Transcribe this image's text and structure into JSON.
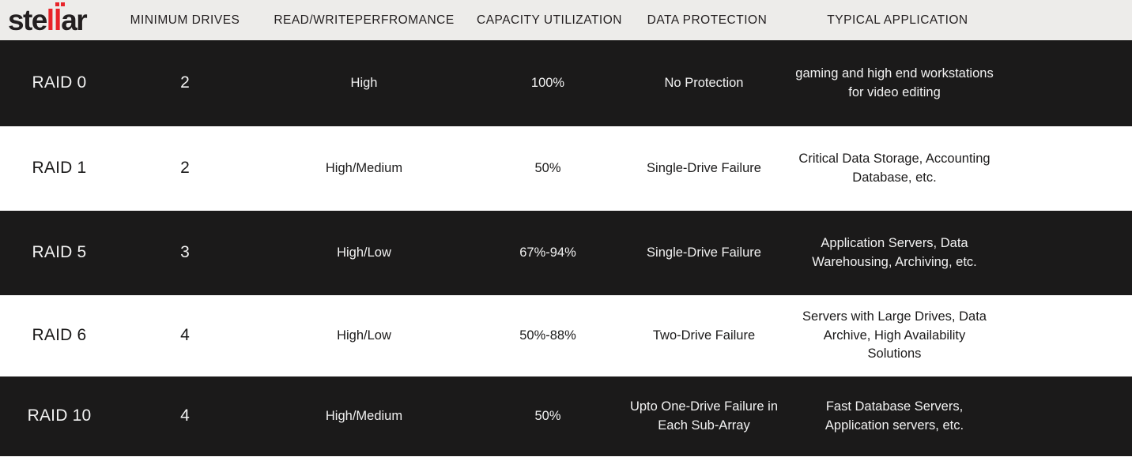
{
  "brand": {
    "name": "stellar",
    "name_part1": "ste",
    "name_part2": "ll",
    "name_part3": "ar",
    "accent_color": "#e8242a",
    "text_color": "#231f20"
  },
  "theme": {
    "header_bg": "#edecea",
    "dark_row_bg": "#1b1a1a",
    "light_row_bg": "#ffffff",
    "dark_row_text": "#f2f2f2",
    "light_row_text": "#1b1a1a"
  },
  "table": {
    "columns": [
      "",
      "MINIMUM DRIVES",
      "READ/WRITEPERFROMANCE",
      "CAPACITY UTILIZATION",
      "DATA PROTECTION",
      "TYPICAL APPLICATION"
    ],
    "rows": [
      {
        "level": "RAID 0",
        "minimum_drives": "2",
        "read_write_performance": "High",
        "capacity_utilization": "100%",
        "data_protection": "No Protection",
        "typical_application": "gaming and high end workstations for video editing",
        "style": "dark"
      },
      {
        "level": "RAID 1",
        "minimum_drives": "2",
        "read_write_performance": "High/Medium",
        "capacity_utilization": "50%",
        "data_protection": "Single-Drive Failure",
        "typical_application": "Critical Data Storage, Accounting Database, etc.",
        "style": "light"
      },
      {
        "level": "RAID 5",
        "minimum_drives": "3",
        "read_write_performance": "High/Low",
        "capacity_utilization": "67%-94%",
        "data_protection": "Single-Drive Failure",
        "typical_application": "Application Servers, Data Warehousing, Archiving, etc.",
        "style": "dark"
      },
      {
        "level": "RAID 6",
        "minimum_drives": "4",
        "read_write_performance": "High/Low",
        "capacity_utilization": "50%-88%",
        "data_protection": "Two-Drive Failure",
        "typical_application": "Servers with Large Drives, Data Archive, High Availability Solutions",
        "style": "light"
      },
      {
        "level": "RAID 10",
        "minimum_drives": "4",
        "read_write_performance": "High/Medium",
        "capacity_utilization": "50%",
        "data_protection": "Upto One-Drive Failure in Each Sub-Array",
        "typical_application": "Fast Database Servers, Application servers, etc.",
        "style": "dark"
      }
    ]
  }
}
